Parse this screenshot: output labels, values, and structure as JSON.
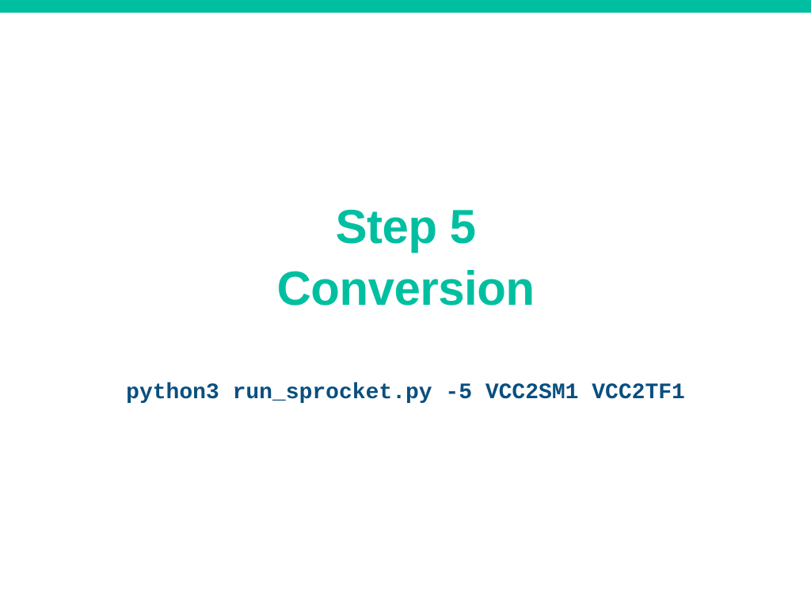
{
  "slide": {
    "title_line_1": "Step 5",
    "title_line_2": "Conversion",
    "command": "python3 run_sprocket.py -5 VCC2SM1 VCC2TF1"
  },
  "colors": {
    "accent": "#00bfa0",
    "command_text": "#0a4f7f",
    "background": "#ffffff"
  }
}
